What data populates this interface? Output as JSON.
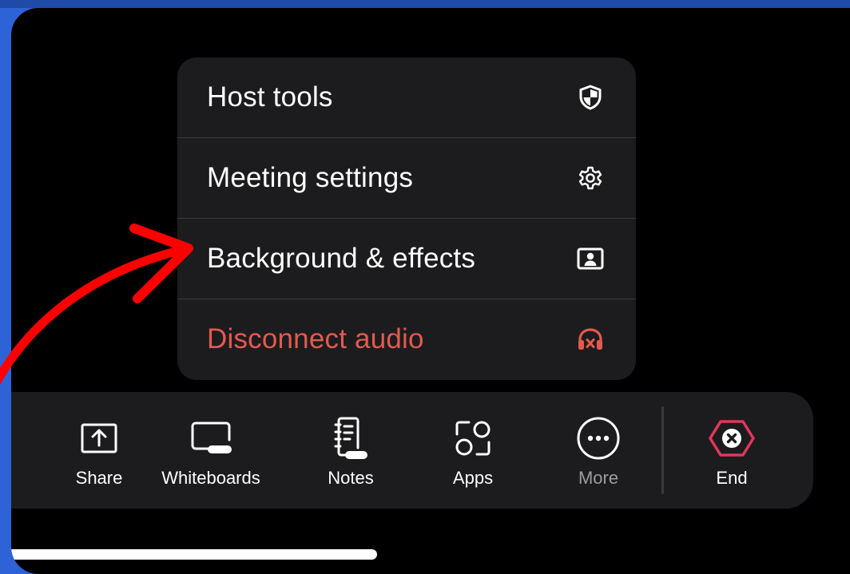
{
  "menu": {
    "items": [
      {
        "label": "Host tools",
        "icon": "shield-icon"
      },
      {
        "label": "Meeting settings",
        "icon": "gear-icon"
      },
      {
        "label": "Background & effects",
        "icon": "portrait-icon"
      },
      {
        "label": "Disconnect audio",
        "icon": "headphones-x-icon"
      }
    ]
  },
  "toolbar": {
    "share_label": "Share",
    "whiteboards_label": "Whiteboards",
    "notes_label": "Notes",
    "apps_label": "Apps",
    "more_label": "More",
    "end_label": "End"
  },
  "colors": {
    "frame_blue": "#2d63d6",
    "panel": "#1c1c1e",
    "danger_text": "#e35a4e",
    "end_red": "#e1375a",
    "annotation_arrow": "#ff0000"
  }
}
